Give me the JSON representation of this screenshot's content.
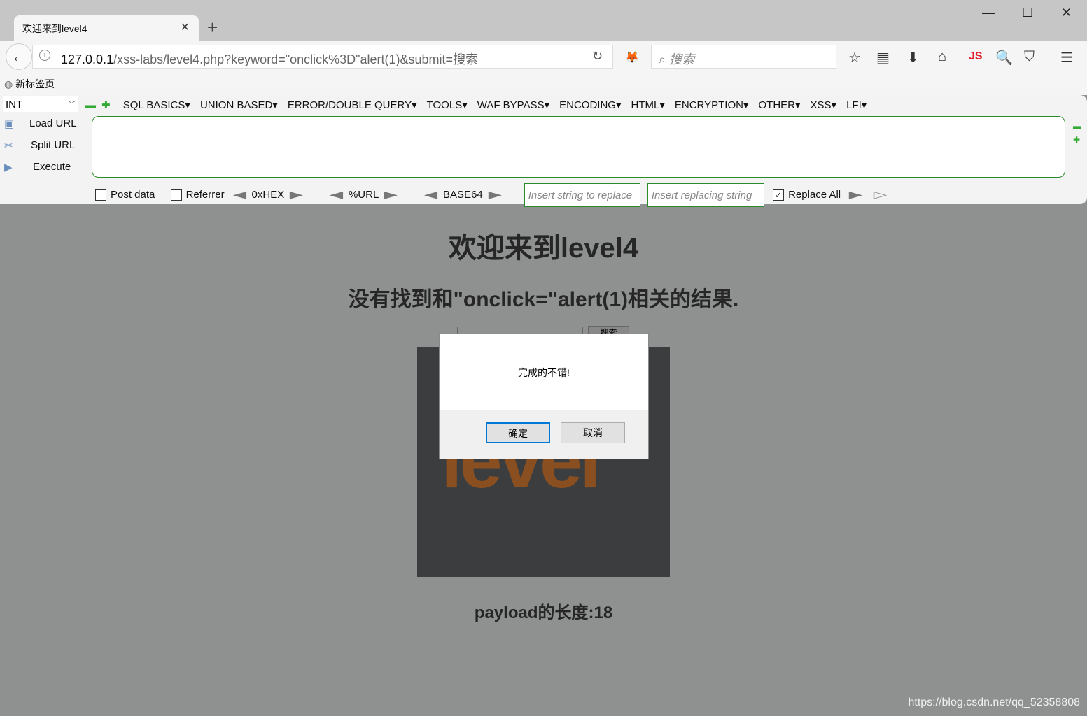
{
  "browser": {
    "tab_title": "欢迎来到level4",
    "new_tab": "+",
    "url_host": "127.0.0.1",
    "url_path": "/xss-labs/level4.php?keyword=\"onclick%3D\"alert(1)&submit=搜索",
    "search_placeholder": "搜索",
    "bookmark": "新标签页",
    "window_controls": [
      "minimize",
      "maximize",
      "close"
    ],
    "toolbar_icons": [
      "star-icon",
      "reading-list-icon",
      "download-icon",
      "home-icon",
      "js-icon",
      "hack-search-icon",
      "pocket-icon",
      "menu-icon"
    ]
  },
  "hackbar": {
    "select": "INT",
    "menus": [
      "SQL BASICS",
      "UNION BASED",
      "ERROR/DOUBLE QUERY",
      "TOOLS",
      "WAF BYPASS",
      "ENCODING",
      "HTML",
      "ENCRYPTION",
      "OTHER",
      "XSS",
      "LFI"
    ],
    "load_url": "Load URL",
    "split_url": "Split URL",
    "execute": "Execute",
    "url_value": "",
    "post_data": "Post data",
    "referrer": "Referrer",
    "hex": "0xHEX",
    "urlenc": "%URL",
    "base64": "BASE64",
    "replace_placeholder": "Insert string to replace",
    "replacing_placeholder": "Insert replacing string",
    "replace_all": "Replace All",
    "replace_all_checked": true
  },
  "page": {
    "title": "欢迎来到level4",
    "result": "没有找到和\"onclick=\"alert(1)相关的结果.",
    "search_button": "搜索",
    "image_text": "level",
    "payload_length": "payload的长度:18",
    "watermark": "https://blog.csdn.net/qq_52358808"
  },
  "dialog": {
    "message": "完成的不错!",
    "ok": "确定",
    "cancel": "取消",
    "accent": "#0078d7"
  }
}
